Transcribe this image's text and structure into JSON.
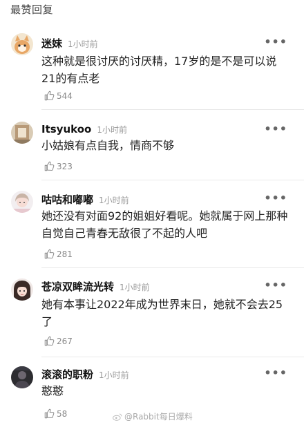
{
  "section_title": "最赞回复",
  "more_label": "•••",
  "comments": [
    {
      "name": "迷妹",
      "time": "1小时前",
      "text": "这种就是很讨厌的讨厌精，17岁的是不是可以说21的有点老",
      "likes": "544",
      "avatar": "cat"
    },
    {
      "name": "Itsyukoo",
      "time": "1小时前",
      "text": "小姑娘有点自我，情商不够",
      "likes": "323",
      "avatar": "room"
    },
    {
      "name": "咕咕和嘟嘟",
      "time": "1小时前",
      "text": "她还没有对面92的姐姐好看呢。她就属于网上那种自觉自己青春无敌很了不起的人吧",
      "likes": "281",
      "avatar": "girl-light"
    },
    {
      "name": "苍凉双眸流光转",
      "time": "1小时前",
      "text": "她有本事让2022年成为世界末日，她就不会去25了",
      "likes": "267",
      "avatar": "girl-dark"
    },
    {
      "name": "滚滚的职粉",
      "time": "1小时前",
      "text": "憨憨",
      "likes": "58",
      "avatar": "person-dark"
    }
  ],
  "watermark": "@Rabbit每日爆料"
}
